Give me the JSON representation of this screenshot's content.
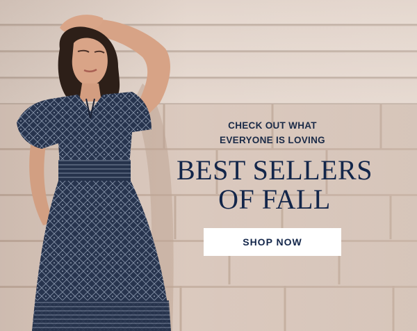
{
  "banner": {
    "eyebrow_line1": "CHECK OUT WHAT",
    "eyebrow_line2": "EVERYONE IS LOVING",
    "headline_line1": "BEST SELLERS",
    "headline_line2": "OF FALL",
    "cta_label": "SHOP NOW"
  },
  "colors": {
    "navy": "#13264a",
    "wall": "#ddcabe",
    "dress": "#26344f",
    "button_bg": "#ffffff"
  }
}
